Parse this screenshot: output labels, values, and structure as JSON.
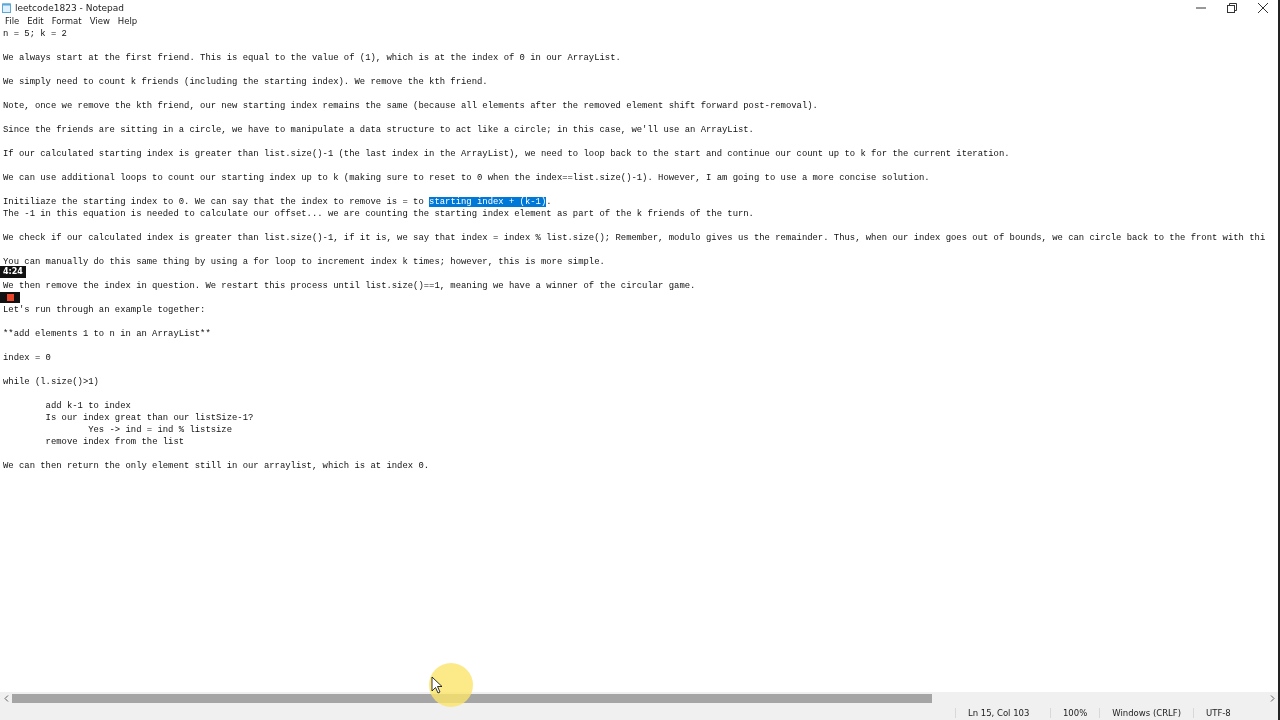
{
  "window": {
    "title": "leetcode1823 - Notepad"
  },
  "menu": [
    "File",
    "Edit",
    "Format",
    "View",
    "Help"
  ],
  "editor": {
    "blocks": [
      {
        "lines": [
          {
            "text": "n = 5; k = 2"
          }
        ]
      },
      {
        "lines": [
          {
            "text": "We always start at the first friend. This is equal to the value of (1), which is at the index of 0 in our ArrayList."
          }
        ]
      },
      {
        "lines": [
          {
            "text": "We simply need to count k friends (including the starting index). We remove the kth friend."
          }
        ]
      },
      {
        "lines": [
          {
            "text": "Note, once we remove the kth friend, our new starting index remains the same (because all elements after the removed element shift forward post-removal)."
          }
        ]
      },
      {
        "lines": [
          {
            "text": "Since the friends are sitting in a circle, we have to manipulate a data structure to act like a circle; in this case, we'll use an ArrayList."
          }
        ]
      },
      {
        "lines": [
          {
            "text": "If our calculated starting index is greater than list.size()-1 (the last index in the ArrayList), we need to loop back to the start and continue our count up to k for the current iteration."
          }
        ]
      },
      {
        "lines": [
          {
            "text": "We can use additional loops to count our starting index up to k (making sure to reset to 0 when the index==list.size()-1). However, I am going to use a more concise solution."
          }
        ]
      },
      {
        "lines": [
          {
            "text": "Initiliaze the starting index to 0. We can say that the index to remove is = to ",
            "selection": "starting index + (k-1)",
            "rest": "."
          },
          {
            "text": "The -1 in this equation is needed to calculate our offset... we are counting the starting index element as part of the k friends of the turn."
          }
        ]
      },
      {
        "lines": [
          {
            "text": "We check if our calculated index is greater than list.size()-1, if it is, we say that index = index % list.size(); Remember, modulo gives us the remainder. Thus, when our index goes out of bounds, we can circle back to the front with thi"
          }
        ]
      },
      {
        "lines": [
          {
            "text": "You can manually do this same thing by using a for loop to increment index k times; however, this is more simple."
          }
        ]
      },
      {
        "lines": [
          {
            "text": "We then remove the index in question. We restart this process until list.size()==1, meaning we have a winner of the circular game."
          }
        ]
      },
      {
        "lines": [
          {
            "text": "Let's run through an example together:"
          }
        ]
      },
      {
        "lines": [
          {
            "text": "**add elements 1 to n in an ArrayList**"
          }
        ]
      },
      {
        "lines": [
          {
            "text": "index = 0"
          }
        ]
      },
      {
        "lines": [
          {
            "text": "while (l.size()>1)"
          }
        ]
      },
      {
        "lines": [
          {
            "text": "\tadd k-1 to index"
          },
          {
            "text": "\tIs our index great than our listSize-1?"
          },
          {
            "text": "\t\tYes -> ind = ind % listsize"
          },
          {
            "text": "\tremove index from the list"
          }
        ]
      },
      {
        "lines": [
          {
            "text": "We can then return the only element still in our arraylist, which is at index 0."
          }
        ]
      }
    ]
  },
  "recorder": {
    "timer": "4:24"
  },
  "status_bar": [
    "Ln 15, Col 103",
    "100%",
    "Windows (CRLF)",
    "UTF-8"
  ]
}
